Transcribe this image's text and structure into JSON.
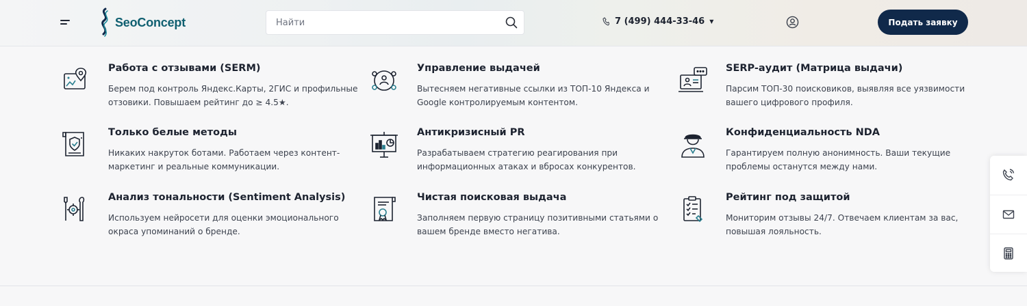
{
  "header": {
    "logo_text": "SeoConcept",
    "search_placeholder": "Найти",
    "phone": "7 (499) 444-33-46",
    "cta_label": "Подать заявку"
  },
  "colors": {
    "brand_dark": "#10294a",
    "logo_teal": "#0f5f70",
    "text": "#1d2330",
    "muted_text": "#3c424e"
  },
  "services": [
    {
      "icon": "map-pin-icon",
      "title": "Работа с отзывами (SERM)",
      "desc": "Берем под контроль Яндекс.Карты, 2ГИС и профильные отзовики. Повышаем рейтинг до ≥ 4.5★."
    },
    {
      "icon": "people-network-icon",
      "title": "Управление выдачей",
      "desc": "Вытесняем негативные ссылки из ТОП-10 Яндекса и Google контролируемым контентом."
    },
    {
      "icon": "laptop-chat-icon",
      "title": "SERP-аудит (Матрица выдачи)",
      "desc": "Парсим ТОП-30 поисковиков, выявляя все уязвимости вашего цифрового профиля."
    },
    {
      "icon": "shield-document-icon",
      "title": "Только белые методы",
      "desc": "Никаких накруток ботами. Работаем через контент-маркетинг и реальные коммуникации."
    },
    {
      "icon": "presentation-board-icon",
      "title": "Антикризисный PR",
      "desc": "Разрабатываем стратегию реагирования при информационных атаках и вбросах конкурентов."
    },
    {
      "icon": "security-guard-icon",
      "title": "Конфиденциальность NDA",
      "desc": "Гарантируем полную анонимность. Ваши текущие проблемы останутся между нами."
    },
    {
      "icon": "tools-gear-icon",
      "title": "Анализ тональности (Sentiment Analysis)",
      "desc": "Используем нейросети для оценки эмоционального окраса упоминаний о бренде."
    },
    {
      "icon": "certificate-icon",
      "title": "Чистая поисковая выдача",
      "desc": "Заполняем первую страницу позитивными статьями о вашем бренде вместо негатива."
    },
    {
      "icon": "clipboard-checklist-icon",
      "title": "Рейтинг под защитой",
      "desc": "Мониторим отзывы 24/7. Отвечаем клиентам за вас, повышая лояльность."
    }
  ],
  "side_widgets": [
    "phone-callback-icon",
    "mail-icon",
    "calculator-icon"
  ]
}
